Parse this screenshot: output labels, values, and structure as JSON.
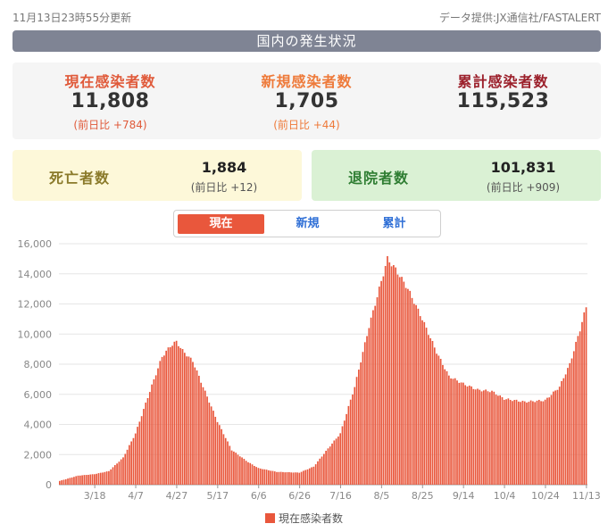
{
  "header": {
    "updated": "11月13日23時55分更新",
    "source": "データ提供:JX通信社/FASTALERT",
    "banner": "国内の発生状況"
  },
  "stats": [
    {
      "label": "現在感染者数",
      "value": "11,808",
      "diff": "(前日比 +784)"
    },
    {
      "label": "新規感染者数",
      "value": "1,705",
      "diff": "(前日比 +44)"
    },
    {
      "label": "累計感染者数",
      "value": "115,523",
      "diff": ""
    }
  ],
  "deaths": {
    "label": "死亡者数",
    "value": "1,884",
    "diff": "(前日比 +12)"
  },
  "discharged": {
    "label": "退院者数",
    "value": "101,831",
    "diff": "(前日比 +909)"
  },
  "tabs": [
    {
      "label": "現在",
      "active": true
    },
    {
      "label": "新規",
      "active": false
    },
    {
      "label": "累計",
      "active": false
    }
  ],
  "colors": {
    "bar": "#e9573c",
    "grid": "#e6e6e6",
    "axis": "#999999"
  },
  "chart_data": {
    "type": "bar",
    "series": [
      {
        "name": "現在感染者数",
        "color": "#e9573c"
      }
    ],
    "ylim": [
      0,
      16000
    ],
    "yticks": [
      0,
      2000,
      4000,
      6000,
      8000,
      10000,
      12000,
      14000,
      16000
    ],
    "ytick_labels": [
      "0",
      "2,000",
      "4,000",
      "6,000",
      "8,000",
      "10,000",
      "12,000",
      "14,000",
      "16,000"
    ],
    "xticks": [
      "3/18",
      "4/7",
      "4/27",
      "5/17",
      "6/6",
      "6/26",
      "7/16",
      "8/5",
      "8/25",
      "9/14",
      "10/4",
      "10/24",
      "11/13"
    ],
    "start_label": "3/1",
    "keypoints": [
      [
        "3/1",
        250
      ],
      [
        "3/10",
        600
      ],
      [
        "3/18",
        700
      ],
      [
        "3/25",
        900
      ],
      [
        "4/1",
        1800
      ],
      [
        "4/7",
        3400
      ],
      [
        "4/14",
        6200
      ],
      [
        "4/20",
        8500
      ],
      [
        "4/24",
        9200
      ],
      [
        "4/27",
        9500
      ],
      [
        "4/30",
        8900
      ],
      [
        "5/5",
        8200
      ],
      [
        "5/10",
        6500
      ],
      [
        "5/17",
        4200
      ],
      [
        "5/24",
        2300
      ],
      [
        "6/1",
        1500
      ],
      [
        "6/6",
        1100
      ],
      [
        "6/15",
        850
      ],
      [
        "6/26",
        800
      ],
      [
        "7/3",
        1200
      ],
      [
        "7/10",
        2400
      ],
      [
        "7/16",
        3400
      ],
      [
        "7/23",
        6500
      ],
      [
        "7/30",
        10500
      ],
      [
        "8/5",
        13500
      ],
      [
        "8/8",
        15000
      ],
      [
        "8/12",
        14300
      ],
      [
        "8/18",
        13000
      ],
      [
        "8/25",
        11000
      ],
      [
        "9/1",
        8800
      ],
      [
        "9/7",
        7200
      ],
      [
        "9/14",
        6700
      ],
      [
        "9/21",
        6300
      ],
      [
        "9/28",
        6200
      ],
      [
        "10/4",
        5700
      ],
      [
        "10/14",
        5500
      ],
      [
        "10/24",
        5600
      ],
      [
        "10/31",
        6500
      ],
      [
        "11/5",
        8000
      ],
      [
        "11/10",
        10300
      ],
      [
        "11/13",
        11808
      ]
    ]
  },
  "legend": {
    "label": "現在感染者数"
  }
}
